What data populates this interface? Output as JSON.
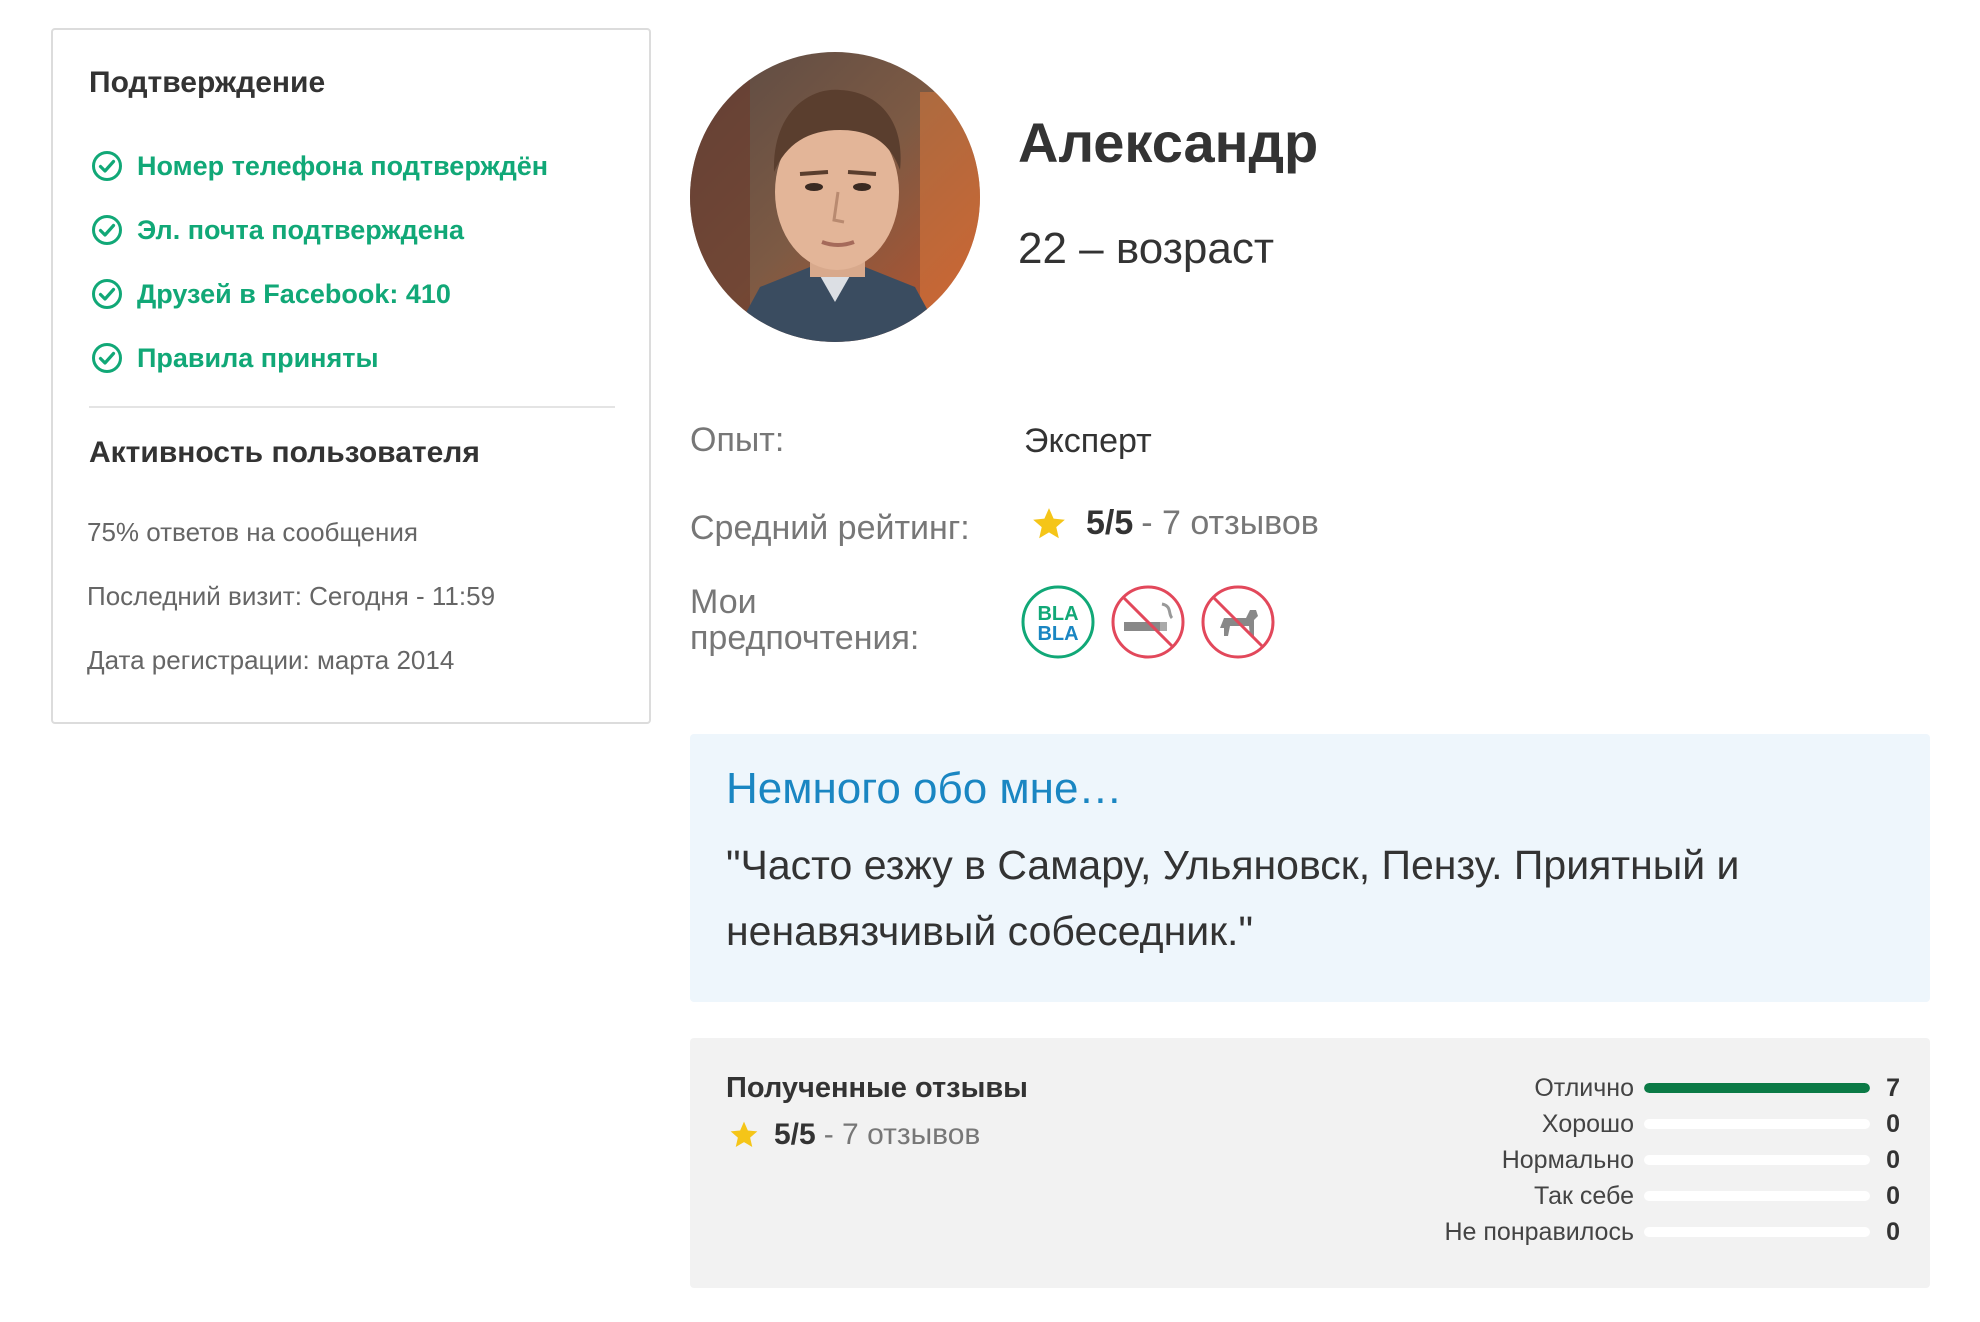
{
  "verification": {
    "title": "Подтверждение",
    "items": [
      {
        "label": "Номер телефона подтверждён"
      },
      {
        "label": "Эл. почта подтверждена"
      },
      {
        "label": "Друзей в Facebook: 410"
      },
      {
        "label": "Правила приняты"
      }
    ]
  },
  "activity": {
    "title": "Активность пользователя",
    "items": [
      {
        "label": "75% ответов на сообщения"
      },
      {
        "label": "Последний визит: Сегодня - 11:59"
      },
      {
        "label": "Дата регистрации: марта 2014"
      }
    ]
  },
  "profile": {
    "name": "Александр",
    "age": "22 – возраст"
  },
  "info": {
    "experience_label": "Опыт:",
    "experience_value": "Эксперт",
    "rating_label": "Средний рейтинг:",
    "rating_score": "5/5",
    "rating_reviews": "- 7 отзывов",
    "preferences_label": "Мои предпочтения:",
    "preferences": [
      {
        "icon": "bla-bla-icon",
        "text1": "BLA",
        "text2": "BLA"
      },
      {
        "icon": "no-smoking-icon"
      },
      {
        "icon": "no-pets-icon"
      }
    ]
  },
  "about": {
    "title": "Немного обо мне…",
    "text": "\"Часто езжу в Самару, Ульяновск, Пензу. Приятный и ненавязчивый собеседник.\""
  },
  "reviews": {
    "title": "Полученные отзывы",
    "score": "5/5",
    "count_text": "- 7 отзывов",
    "breakdown": [
      {
        "label": "Отлично",
        "count": "7",
        "fraction": 1.0
      },
      {
        "label": "Хорошо",
        "count": "0",
        "fraction": 0
      },
      {
        "label": "Нормально",
        "count": "0",
        "fraction": 0
      },
      {
        "label": "Так себе",
        "count": "0",
        "fraction": 0
      },
      {
        "label": "Не понравилось",
        "count": "0",
        "fraction": 0
      }
    ]
  },
  "colors": {
    "verified_green": "#11a877",
    "about_blue": "#1a86c2",
    "bar_green": "#0b7a46",
    "star_yellow": "#f5c518",
    "bla_green": "#11a877",
    "no_red": "#e2485b"
  }
}
